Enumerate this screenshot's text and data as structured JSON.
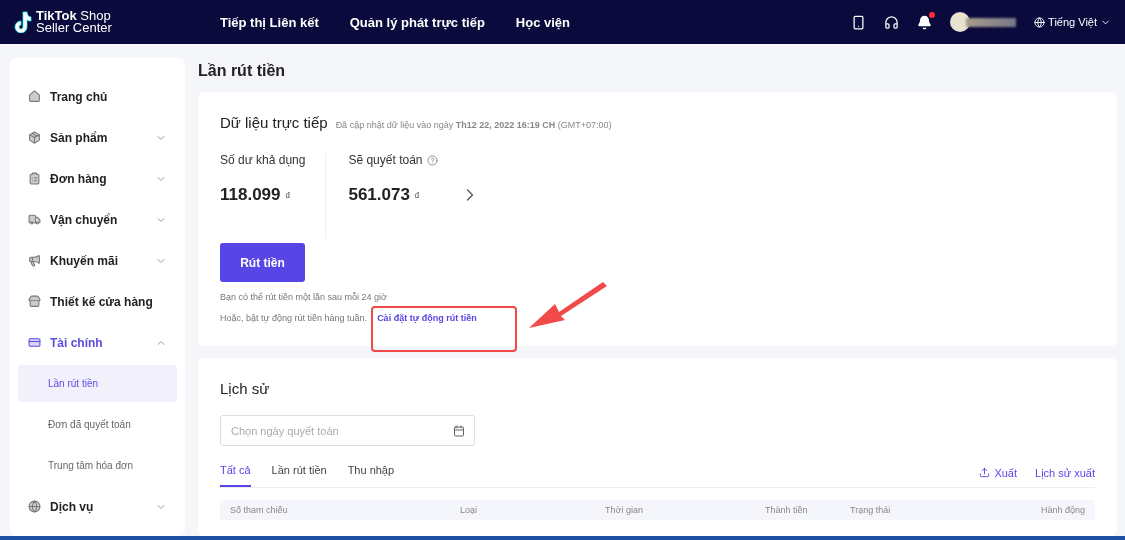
{
  "header": {
    "logo_bold": "TikTok",
    "logo_light": "Shop",
    "logo_sub": "Seller Center",
    "nav": [
      "Tiếp thị Liên kết",
      "Quản lý phát trực tiếp",
      "Học viện"
    ],
    "has_unread": true,
    "language": "Tiếng Việt"
  },
  "sidebar": {
    "items": [
      {
        "label": "Trang chủ",
        "kind": "link",
        "selected": false
      },
      {
        "label": "Sản phẩm",
        "kind": "group",
        "expanded": false,
        "selected": false
      },
      {
        "label": "Đơn hàng",
        "kind": "group",
        "expanded": false,
        "selected": false
      },
      {
        "label": "Vận chuyển",
        "kind": "group",
        "expanded": false,
        "selected": false
      },
      {
        "label": "Khuyến mãi",
        "kind": "group",
        "expanded": false,
        "selected": false
      },
      {
        "label": "Thiết kế cửa hàng",
        "kind": "link",
        "selected": false
      },
      {
        "label": "Tài chính",
        "kind": "group",
        "expanded": true,
        "selected": true,
        "children": [
          {
            "label": "Lần rút tiền",
            "selected": true
          },
          {
            "label": "Đơn đã quyết toán",
            "selected": false
          },
          {
            "label": "Trung tâm hóa đơn",
            "selected": false
          }
        ]
      },
      {
        "label": "Dịch vụ",
        "kind": "group",
        "expanded": false,
        "selected": false
      }
    ]
  },
  "page_title": "Lần rút tiền",
  "live_data": {
    "title": "Dữ liệu trực tiếp",
    "updated": "Đã cập nhật dữ liệu vào ngày **Th12 22, 2022 16:19 CH** (GMT+07:00)",
    "balances": [
      {
        "label": "Số dư khả dụng",
        "amount": "118.099",
        "currency": "₫",
        "kind": "plain"
      },
      {
        "label": "Sẽ quyết toán",
        "amount": "561.073",
        "currency": "₫",
        "kind": "detail"
      }
    ],
    "button": "Rút tiền",
    "note": "Bạn có thể rút tiền một lần sau mỗi 24 giờ",
    "note2": "Hoặc, bật tự động rút tiền hàng tuần.",
    "link": "Cài đặt tự động rút tiền"
  },
  "history": {
    "title": "Lịch sử",
    "date_field": {
      "placeholder": "Chọn ngày quyết toán"
    },
    "tabs": [
      {
        "label": "Tất cả",
        "selected": true
      },
      {
        "label": "Lần rút tiền",
        "selected": false
      },
      {
        "label": "Thu nhập",
        "selected": false
      }
    ],
    "export": "Xuất",
    "export_history": "Lịch sử xuất",
    "table": {
      "columns": [
        "Số tham chiếu",
        "Loại",
        "Thời gian",
        "Thành tiền",
        "Trạng thái",
        "Hành động"
      ]
    }
  }
}
